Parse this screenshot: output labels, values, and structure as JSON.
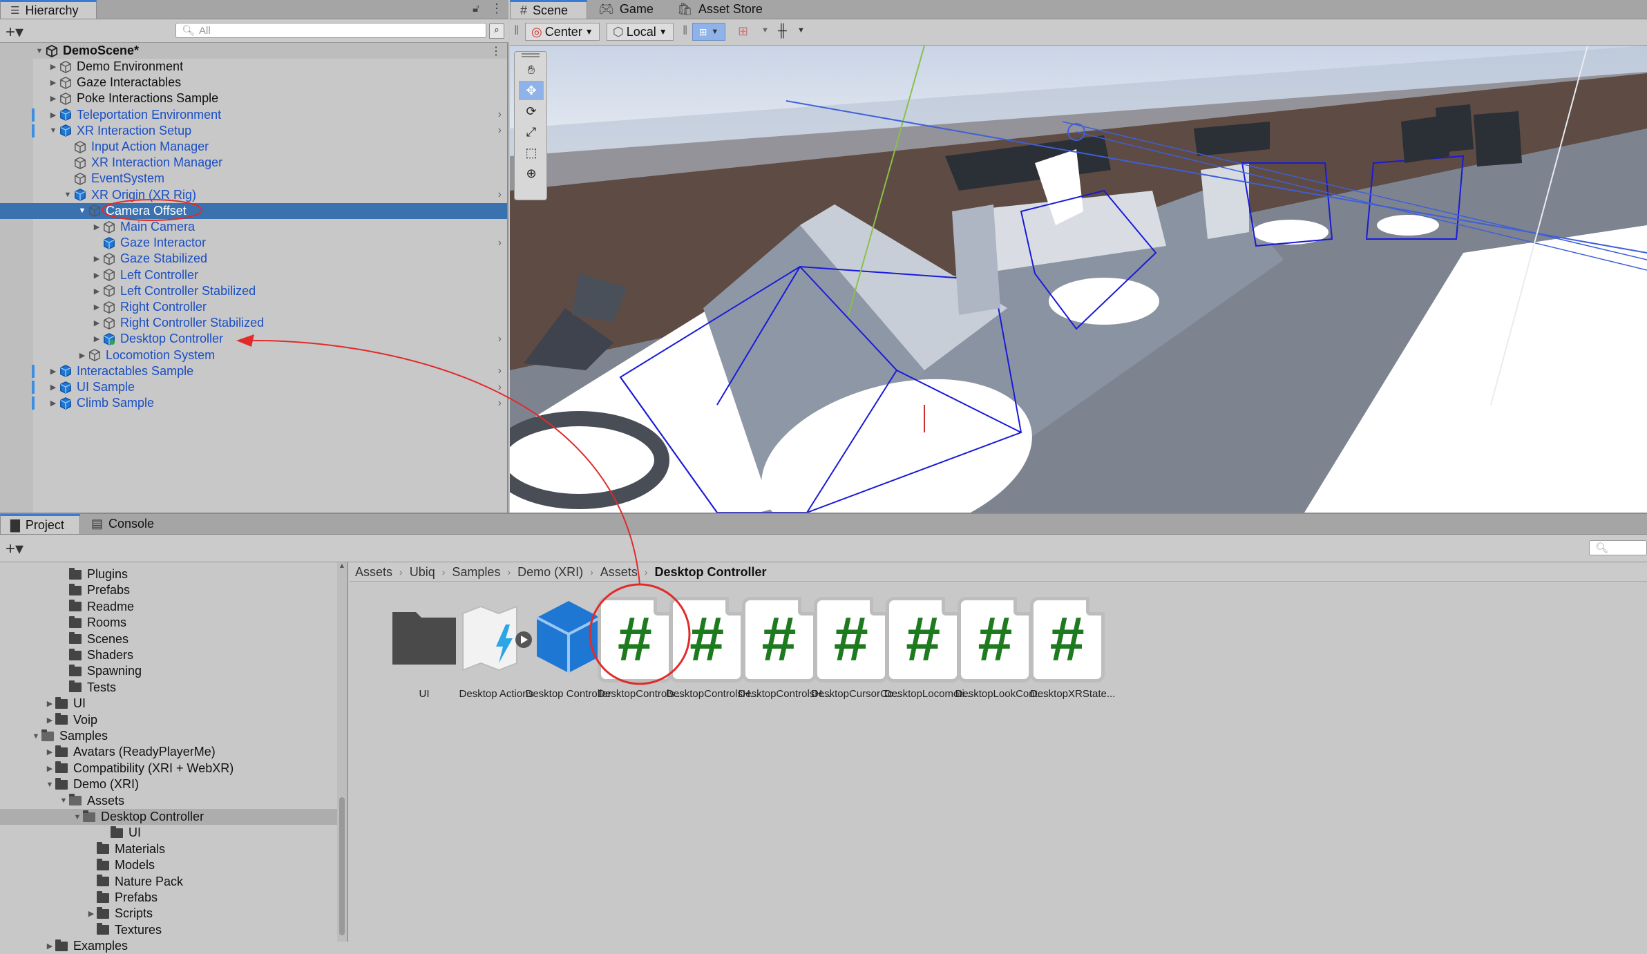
{
  "hierarchy": {
    "tab_label": "Hierarchy",
    "search_placeholder": "All",
    "scene_name": "DemoScene*",
    "items": [
      {
        "label": "Demo Environment",
        "blue": false
      },
      {
        "label": "Gaze Interactables",
        "blue": false
      },
      {
        "label": "Poke Interactions Sample",
        "blue": false
      },
      {
        "label": "Teleportation Environment",
        "blue": true
      },
      {
        "label": "XR Interaction Setup",
        "blue": true
      },
      {
        "label": "Input Action Manager",
        "blue": true
      },
      {
        "label": "XR Interaction Manager",
        "blue": true
      },
      {
        "label": "EventSystem",
        "blue": true
      },
      {
        "label": "XR Origin (XR Rig)",
        "blue": true
      },
      {
        "label": "Camera Offset",
        "blue": true
      },
      {
        "label": "Main Camera",
        "blue": true
      },
      {
        "label": "Gaze Interactor",
        "blue": true
      },
      {
        "label": "Gaze Stabilized",
        "blue": true
      },
      {
        "label": "Left Controller",
        "blue": true
      },
      {
        "label": "Left Controller Stabilized",
        "blue": true
      },
      {
        "label": "Right Controller",
        "blue": true
      },
      {
        "label": "Right Controller Stabilized",
        "blue": true
      },
      {
        "label": "Desktop Controller",
        "blue": true
      },
      {
        "label": "Locomotion System",
        "blue": true
      },
      {
        "label": "Interactables Sample",
        "blue": true
      },
      {
        "label": "UI Sample",
        "blue": true
      },
      {
        "label": "Climb Sample",
        "blue": true
      }
    ]
  },
  "scene_tabs": {
    "scene": "Scene",
    "game": "Game",
    "asset_store": "Asset Store"
  },
  "scene_toolbar": {
    "pivot": "Center",
    "space": "Local"
  },
  "bottom_tabs": {
    "project": "Project",
    "console": "Console"
  },
  "project_tree": [
    "Plugins",
    "Prefabs",
    "Readme",
    "Rooms",
    "Scenes",
    "Shaders",
    "Spawning",
    "Tests",
    "UI",
    "Voip",
    "Samples",
    "Avatars (ReadyPlayerMe)",
    "Compatibility (XRI + WebXR)",
    "Demo (XRI)",
    "Assets",
    "Desktop Controller",
    "UI",
    "Materials",
    "Models",
    "Nature Pack",
    "Prefabs",
    "Scripts",
    "Textures",
    "Examples"
  ],
  "breadcrumb": [
    "Assets",
    "Ubiq",
    "Samples",
    "Demo (XRI)",
    "Assets",
    "Desktop Controller"
  ],
  "assets": [
    "UI",
    "Desktop Actions",
    "Desktop Controller",
    "DesktopControls...",
    "DesktopControlsH...",
    "DesktopControlsH...",
    "DesktopCursorCo...",
    "DesktopLocomoti...",
    "DesktopLookCont...",
    "DesktopXRState..."
  ],
  "colors": {
    "selection": "#3a72b0",
    "link_blue": "#1a4ec2",
    "annotation_red": "#e02b2b",
    "script_green": "#1e7a1e"
  }
}
